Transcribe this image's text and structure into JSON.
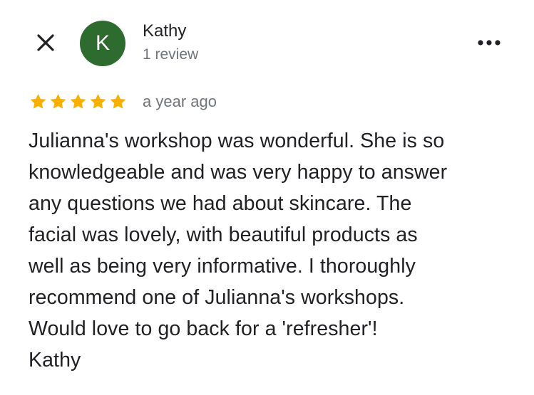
{
  "header": {
    "close_icon": "close-icon",
    "avatar": {
      "initial": "K",
      "color": "#2e6b2f"
    },
    "reviewer_name": "Kathy",
    "review_count": "1 review",
    "more_icon": "more-horizontal-icon"
  },
  "rating": {
    "stars": 5,
    "max_stars": 5,
    "star_color": "#f9b000",
    "timestamp": "a year ago"
  },
  "review": {
    "text": "Julianna's workshop was wonderful.  She is so\nknowledgeable and was very happy to answer\nany questions we had about skincare.  The\nfacial was lovely, with beautiful products as\nwell as being very informative.  I thoroughly\nrecommend one of Julianna's workshops.\nWould love to go back for a 'refresher'!\nKathy"
  }
}
